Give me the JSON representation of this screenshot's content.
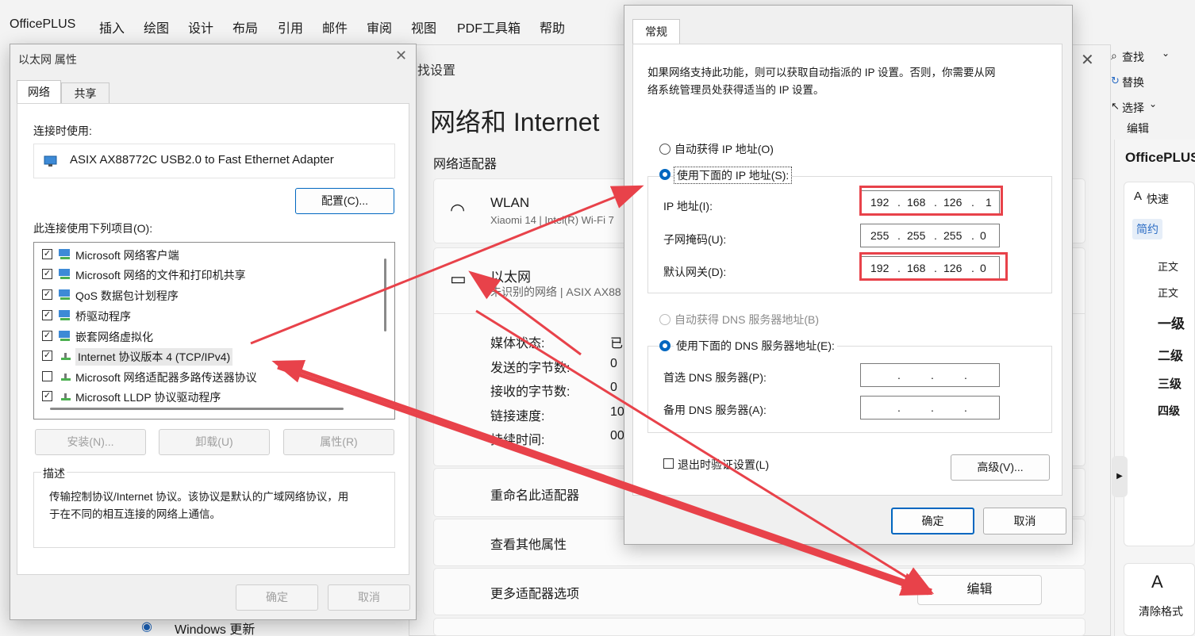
{
  "word": {
    "app_title": "OfficePLUS",
    "menu": [
      "插入",
      "绘图",
      "设计",
      "布局",
      "引用",
      "邮件",
      "审阅",
      "视图",
      "PDF工具箱",
      "帮助"
    ],
    "find_label": "查找",
    "replace_label": "替换",
    "select_label": "选择",
    "edit_group_label": "编辑",
    "pane_title": "OfficePLUS",
    "quick_label": "快速",
    "tab_simple": "简约",
    "styles": [
      "正文",
      "正文",
      "一级",
      "二级",
      "三级",
      "四级"
    ],
    "clear_format": "清除格式"
  },
  "settings": {
    "breadcrumb": "找设置",
    "page_title": "网络和 Internet",
    "section_adapters": "网络适配器",
    "wlan_name": "WLAN",
    "wlan_desc": "Xiaomi 14 | Intel(R) Wi-Fi 7",
    "eth_name": "以太网",
    "eth_desc": "未识别的网络 | ASIX AX88",
    "props": [
      {
        "label": "媒体状态:",
        "value": "已"
      },
      {
        "label": "发送的字节数:",
        "value": "0"
      },
      {
        "label": "接收的字节数:",
        "value": "0"
      },
      {
        "label": "链接速度:",
        "value": "10"
      },
      {
        "label": "持续时间:",
        "value": "00"
      }
    ],
    "rename_adapter": "重命名此适配器",
    "view_more": "查看其他属性",
    "more_options": "更多适配器选项",
    "edit_button": "编辑",
    "windows_update": "Windows 更新"
  },
  "eth_props": {
    "title": "以太网 属性",
    "tab_network": "网络",
    "tab_sharing": "共享",
    "connect_using_label": "连接时使用:",
    "adapter_name": "ASIX AX88772C USB2.0 to Fast Ethernet Adapter",
    "configure_button": "配置(C)...",
    "items_label": "此连接使用下列项目(O):",
    "items": [
      {
        "label": "Microsoft 网络客户端",
        "checked": true
      },
      {
        "label": "Microsoft 网络的文件和打印机共享",
        "checked": true
      },
      {
        "label": "QoS 数据包计划程序",
        "checked": true
      },
      {
        "label": "桥驱动程序",
        "checked": true
      },
      {
        "label": "嵌套网络虚拟化",
        "checked": true
      },
      {
        "label": "Internet 协议版本 4 (TCP/IPv4)",
        "checked": true
      },
      {
        "label": "Microsoft 网络适配器多路传送器协议",
        "checked": false
      },
      {
        "label": "Microsoft LLDP 协议驱动程序",
        "checked": true
      }
    ],
    "install_button": "安装(N)...",
    "uninstall_button": "卸载(U)",
    "properties_button": "属性(R)",
    "description_label": "描述",
    "description_text_1": "传输控制协议/Internet 协议。该协议是默认的广域网络协议，用",
    "description_text_2": "于在不同的相互连接的网络上通信。",
    "ok_button": "确定",
    "cancel_button": "取消"
  },
  "ipv4": {
    "tab_general": "常规",
    "intro_1": "如果网络支持此功能，则可以获取自动指派的 IP 设置。否则，你需要从网",
    "intro_2": "络系统管理员处获得适当的 IP 设置。",
    "auto_ip": "自动获得 IP 地址(O)",
    "manual_ip": "使用下面的 IP 地址(S):",
    "ip_label": "IP 地址(I):",
    "ip_value": [
      "192",
      "168",
      "126",
      "1"
    ],
    "mask_label": "子网掩码(U):",
    "mask_value": [
      "255",
      "255",
      "255",
      "0"
    ],
    "gateway_label": "默认网关(D):",
    "gateway_value": [
      "192",
      "168",
      "126",
      "0"
    ],
    "auto_dns": "自动获得 DNS 服务器地址(B)",
    "manual_dns": "使用下面的 DNS 服务器地址(E):",
    "dns1_label": "首选 DNS 服务器(P):",
    "dns2_label": "备用 DNS 服务器(A):",
    "dots": ".",
    "validate_on_exit": "退出时验证设置(L)",
    "advanced_button": "高级(V)...",
    "ok_button": "确定",
    "cancel_button": "取消"
  },
  "colors": {
    "annotation": "#e8424a",
    "accent": "#0067c0"
  }
}
